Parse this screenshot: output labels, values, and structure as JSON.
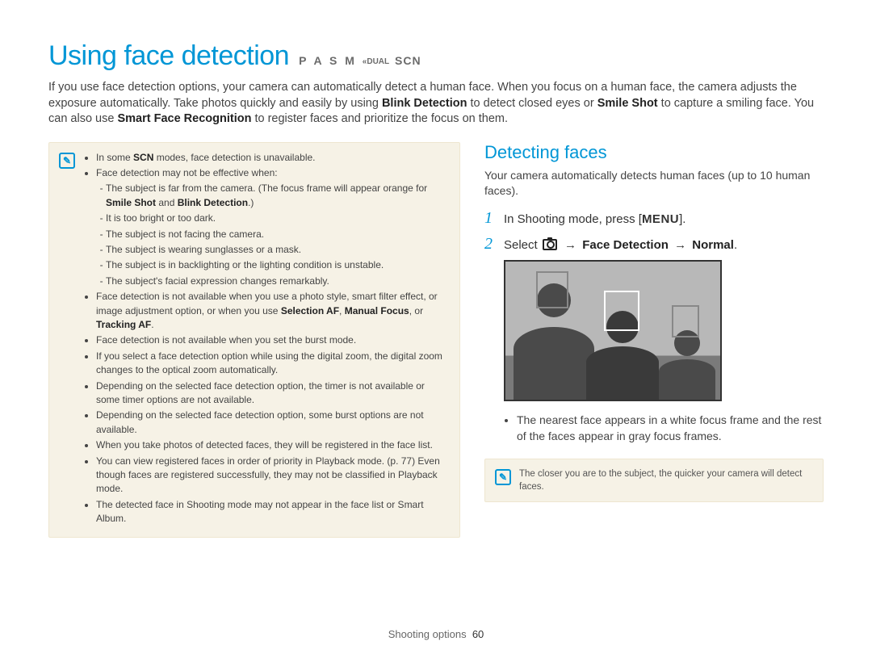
{
  "header": {
    "title": "Using face detection",
    "modes_a": "P A S M",
    "modes_dual": "DUAL",
    "modes_scn": "SCN"
  },
  "intro": {
    "line1_a": "If you use face detection options, your camera can automatically detect a human face. When you focus on a human face, the camera adjusts the exposure automatically. Take photos quickly and easily by using ",
    "b1": "Blink Detection",
    "line1_b": " to detect closed eyes or ",
    "b2": "Smile Shot",
    "line1_c": " to capture a smiling face. You can also use ",
    "b3": "Smart Face Recognition",
    "line1_d": " to register faces and prioritize the focus on them."
  },
  "note_left": {
    "li1a": "In some ",
    "li1_scn": "SCN",
    "li1b": " modes, face detection is unavailable.",
    "li2": "Face detection may not be effective when:",
    "li2_sub1a": "The subject is far from the camera. (The focus frame will appear orange for ",
    "li2_sub1_b1": "Smile Shot",
    "li2_sub1_mid": " and ",
    "li2_sub1_b2": "Blink Detection",
    "li2_sub1_end": ".)",
    "li2_sub2": "It is too bright or too dark.",
    "li2_sub3": "The subject is not facing the camera.",
    "li2_sub4": "The subject is wearing sunglasses or a mask.",
    "li2_sub5": "The subject is in backlighting or the lighting condition is unstable.",
    "li2_sub6": "The subject's facial expression changes remarkably.",
    "li3a": "Face detection is not available when you use a photo style, smart filter effect, or image adjustment option, or when you use ",
    "li3_b1": "Selection AF",
    "li3_mid1": ", ",
    "li3_b2": "Manual Focus",
    "li3_mid2": ", or ",
    "li3_b3": "Tracking AF",
    "li3_end": ".",
    "li4": "Face detection is not available when you set the burst mode.",
    "li5": "If you select a face detection option while using the digital zoom, the digital zoom changes to the optical zoom automatically.",
    "li6": "Depending on the selected face detection option, the timer is not available or some timer options are not available.",
    "li7": "Depending on the selected face detection option, some burst options are not available.",
    "li8": "When you take photos of detected faces, they will be registered in the face list.",
    "li9": "You can view registered faces in order of priority in Playback mode. (p. 77) Even though faces are registered successfully, they may not be classified in Playback mode.",
    "li10": "The detected face in Shooting mode may not appear in the face list or Smart Album."
  },
  "right": {
    "subheading": "Detecting faces",
    "subpara": "Your camera automatically detects human faces (up to 10 human faces).",
    "step1_text_a": "In Shooting mode, press [",
    "step1_menu": "MENU",
    "step1_text_b": "].",
    "step2_text_a": "Select ",
    "step2_arrow1": "→",
    "step2_b1": "Face Detection",
    "step2_arrow2": "→",
    "step2_b2": "Normal",
    "step2_end": ".",
    "bullet": "The nearest face appears in a white focus frame and the rest of the faces appear in gray focus frames.",
    "note_small": "The closer you are to the subject, the quicker your camera will detect faces."
  },
  "footer": {
    "section": "Shooting options",
    "page": "60"
  },
  "icons": {
    "note_glyph": "✎",
    "camera": "camera-icon"
  }
}
